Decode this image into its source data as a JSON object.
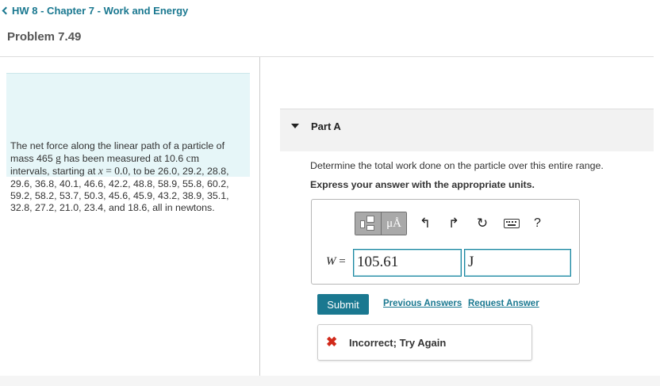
{
  "header": {
    "breadcrumb": "HW 8 - Chapter 7 - Work and Energy",
    "problem_title": "Problem 7.49"
  },
  "problem": {
    "text_1": "The net force along the linear path of a particle of mass 465 ",
    "unit_g": "g",
    "text_2": " has been measured at 10.6 ",
    "unit_cm": "cm",
    "text_3": " intervals, starting at ",
    "var_x": "x",
    "eq": " = 0.0",
    "text_4": ", to be 26.0, 29.2, 28.8, 29.6, 36.8, 40.1, 46.6, 42.2, 48.8, 58.9, 55.8, 60.2, 59.2, 58.2, 53.7, 50.3, 45.6, 45.9, 43.2, 38.9, 35.1, 32.8, 27.2, 21.0, 23.4, and 18.6, all in newtons."
  },
  "part": {
    "label": "Part A",
    "question": "Determine the total work done on the particle over this entire range.",
    "instruction": "Express your answer with the appropriate units."
  },
  "toolbar": {
    "units_label": "μÅ",
    "undo_glyph": "↰",
    "redo_glyph": "↱",
    "reset_glyph": "↻",
    "help_label": "?"
  },
  "answer": {
    "variable": "W",
    "equals": " =",
    "value": "105.61",
    "unit": "J"
  },
  "actions": {
    "submit": "Submit",
    "previous_answers": "Previous Answers",
    "request_answer": "Request Answer"
  },
  "feedback": {
    "icon": "✖",
    "text": "Incorrect; Try Again",
    "color": "#d1291a"
  },
  "colors": {
    "accent": "#1a7890",
    "problem_bg": "#e6f6f8"
  }
}
